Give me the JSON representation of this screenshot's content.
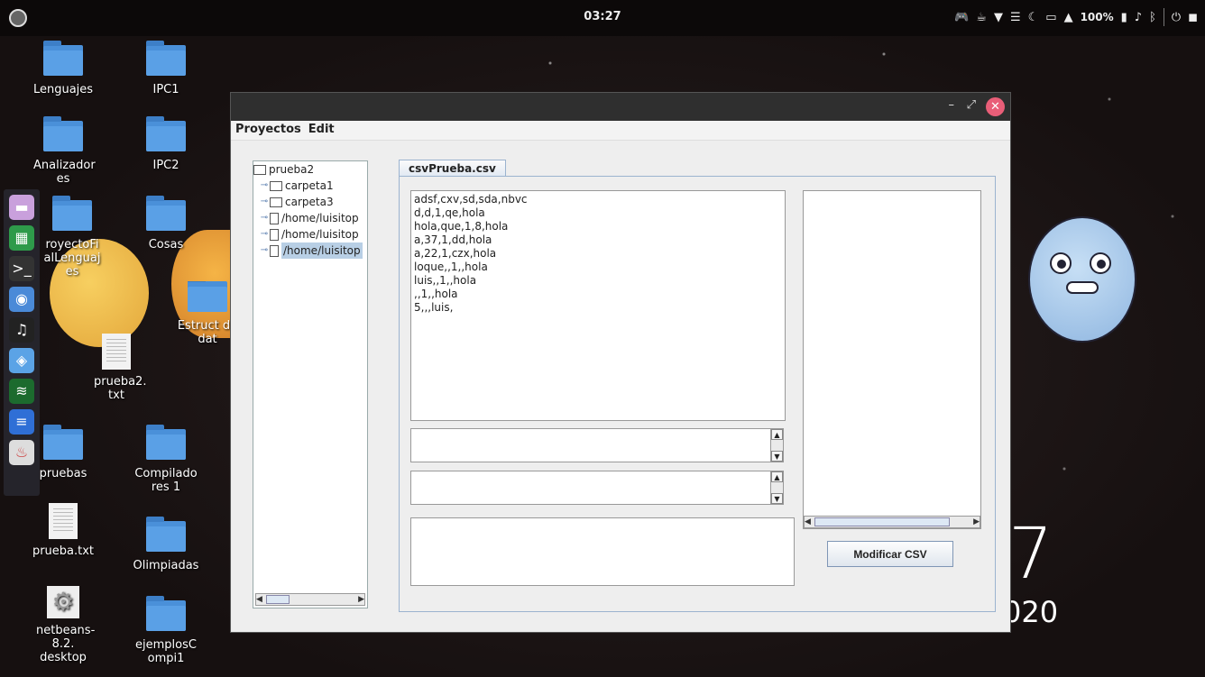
{
  "topbar": {
    "clock": "03:27",
    "battery": "100%"
  },
  "desktop": {
    "icons": [
      {
        "label": "Lenguajes",
        "type": "folder"
      },
      {
        "label": "IPC1",
        "type": "folder"
      },
      {
        "label": "Analizador es",
        "type": "folder"
      },
      {
        "label": "IPC2",
        "type": "folder"
      },
      {
        "label": "royectoFi alLenguaj es",
        "type": "folder"
      },
      {
        "label": "Cosas",
        "type": "folder"
      },
      {
        "label": "Estruct de dat",
        "type": "folder"
      },
      {
        "label": "prueba2. txt",
        "type": "document"
      },
      {
        "label": "pruebas",
        "type": "folder"
      },
      {
        "label": "Compilado res 1",
        "type": "folder"
      },
      {
        "label": "prueba.txt",
        "type": "document"
      },
      {
        "label": "Olimpiadas",
        "type": "folder"
      },
      {
        "label": "netbeans- 8.2. desktop",
        "type": "launcher"
      },
      {
        "label": "ejemplosC ompi1",
        "type": "folder"
      }
    ],
    "clock_big": "7",
    "year_partial": "020"
  },
  "window": {
    "menu": [
      "Proyectos",
      "Edit"
    ],
    "tree": {
      "root": "prueba2",
      "children": [
        "carpeta1",
        "carpeta3",
        "/home/luisitop",
        "/home/luisitop",
        "/home/luisitop"
      ]
    },
    "tab": "csvPrueba.csv",
    "csv_lines": "adsf,cxv,sd,sda,nbvc\nd,d,1,qe,hola\nhola,que,1,8,hola\na,37,1,dd,hola\na,22,1,czx,hola\nloque,,1,,hola\nluis,,1,,hola\n,,1,,hola\n5,,,luis,",
    "button": "Modificar CSV"
  },
  "colors": {
    "close_button": "#e95e78",
    "folder_blue": "#5aa0e6",
    "selection": "#b8cfe5"
  }
}
